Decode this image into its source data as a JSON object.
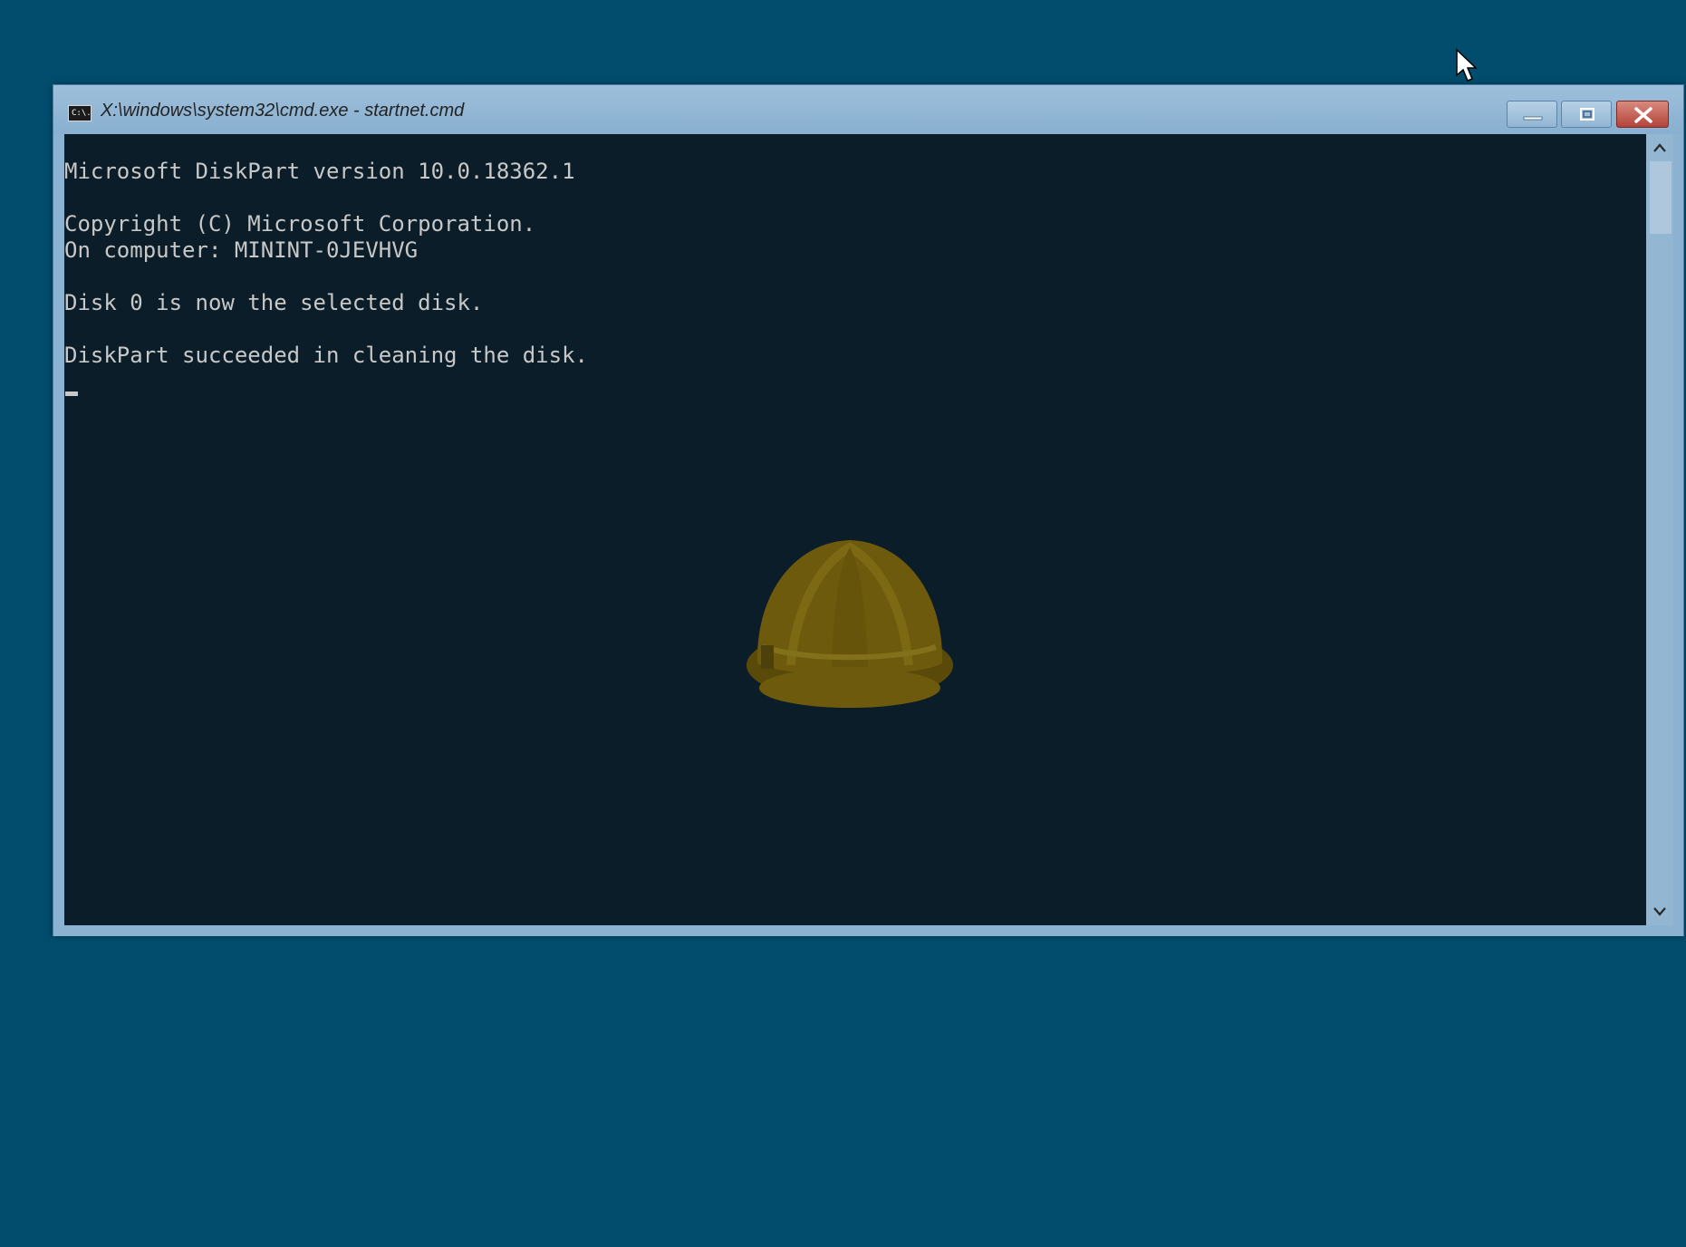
{
  "window": {
    "title": "X:\\windows\\system32\\cmd.exe - startnet.cmd",
    "icon_text": "C:\\."
  },
  "console": {
    "lines": [
      "Microsoft DiskPart version 10.0.18362.1",
      "",
      "Copyright (C) Microsoft Corporation.",
      "On computer: MININT-0JEVHVG",
      "",
      "Disk 0 is now the selected disk.",
      "",
      "DiskPart succeeded in cleaning the disk."
    ]
  },
  "icons": {
    "app": "cmd-app-icon",
    "minimize": "minimize-icon",
    "maximize": "restore-icon",
    "close": "close-icon",
    "scroll_up": "chevron-up-icon",
    "scroll_down": "chevron-down-icon",
    "watermark": "hard-hat-icon",
    "pointer": "mouse-pointer-icon"
  },
  "colors": {
    "desktop": "#024d6e",
    "console_bg": "#0a1d28",
    "console_text": "#c8c8c8",
    "titlebar": "#8cb2d1",
    "close_button": "#c0453a",
    "helmet": "#6e5a0c"
  }
}
